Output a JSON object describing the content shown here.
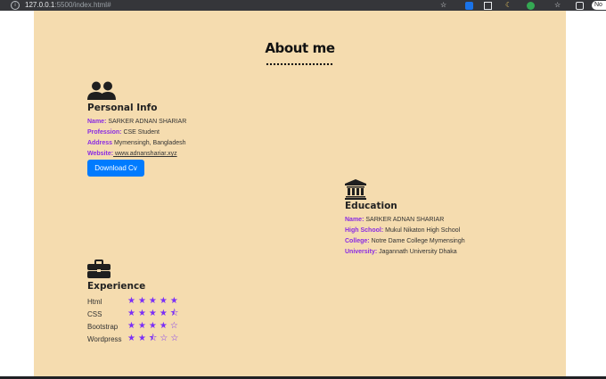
{
  "browser": {
    "url_host": "127.0.0.1",
    "url_path": ":5500/index.html#",
    "profile_label": "No"
  },
  "page": {
    "heading": "About me",
    "personal": {
      "title": "Personal Info",
      "rows": [
        {
          "key": "Name:",
          "value": " SARKER ADNAN SHARIAR"
        },
        {
          "key": "Profession:",
          "value": " CSE Student"
        },
        {
          "key": "Address",
          "value": " Mymensingh, Bangladesh"
        },
        {
          "key": "Website:",
          "value": " www.adnanshariar.xyz"
        }
      ],
      "button_label": "Download Cv"
    },
    "education": {
      "title": "Education",
      "rows": [
        {
          "key": "Name:",
          "value": " SARKER ADNAN SHARIAR"
        },
        {
          "key": "High School:",
          "value": " Mukul Nikaton High School"
        },
        {
          "key": "College:",
          "value": " Notre Dame College Mymensingh"
        },
        {
          "key": "University:",
          "value": " Jagannath University Dhaka"
        }
      ]
    },
    "experience": {
      "title": "Experience",
      "skills": [
        {
          "name": "Html",
          "rating": 5,
          "stars": "★★★★★"
        },
        {
          "name": "CSS",
          "rating": 4.5,
          "stars": "★★★★⯪"
        },
        {
          "name": "Bootstrap",
          "rating": 4,
          "stars": "★★★★☆"
        },
        {
          "name": "Wordpress",
          "rating": 2.5,
          "stars": "★★⯪☆☆"
        }
      ]
    }
  },
  "icons": {
    "info": "info-icon",
    "star_bookmark": "bookmark-star-icon",
    "users": "users-icon",
    "bank": "university-icon",
    "briefcase": "briefcase-icon"
  },
  "colors": {
    "page_bg": "#f5dcaf",
    "label": "#8a2be2",
    "button": "#007bff",
    "stars": "#7b2ff7"
  }
}
